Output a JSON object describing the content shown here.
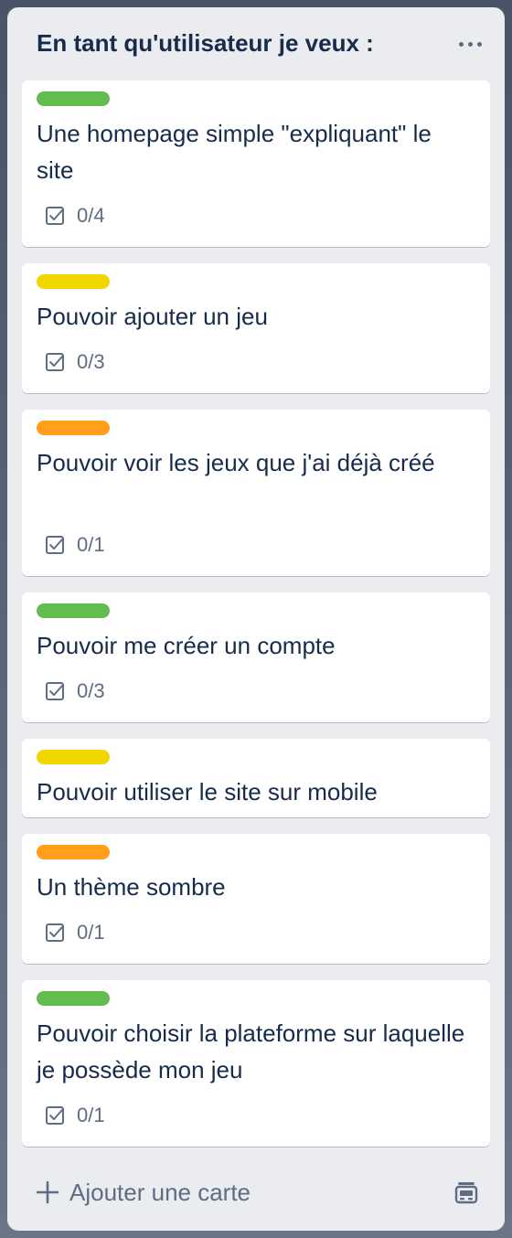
{
  "list": {
    "title": "En tant qu'utilisateur je veux :",
    "menu_icon": "more-horizontal-icon"
  },
  "colors": {
    "green": "#61bd4f",
    "yellow": "#f2d600",
    "orange": "#ff9f1a",
    "text": "#172b4d",
    "muted": "#5e6c84",
    "list_bg": "#ebecf0"
  },
  "cards": [
    {
      "label_color": "green",
      "title": "Une homepage simple \"expliquant\" le site",
      "checklist": "0/4"
    },
    {
      "label_color": "yellow",
      "title": "Pouvoir ajouter un jeu",
      "checklist": "0/3"
    },
    {
      "label_color": "orange",
      "title": "Pouvoir voir les jeux que j'ai déjà créé",
      "checklist": "0/1"
    },
    {
      "label_color": "green",
      "title": "Pouvoir me créer un compte",
      "checklist": "0/3"
    },
    {
      "label_color": "yellow",
      "title": "Pouvoir utiliser le site sur mobile",
      "checklist": null
    },
    {
      "label_color": "orange",
      "title": "Un thème sombre",
      "checklist": "0/1"
    },
    {
      "label_color": "green",
      "title": "Pouvoir choisir la plateforme sur laquelle je possède mon jeu",
      "checklist": "0/1"
    }
  ],
  "footer": {
    "add_label": "Ajouter une carte",
    "add_icon": "plus-icon",
    "template_icon": "card-template-icon"
  }
}
